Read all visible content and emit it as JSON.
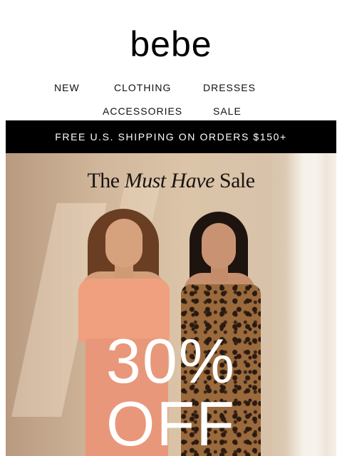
{
  "brand": {
    "logo_text": "bebe"
  },
  "nav": {
    "row1": [
      "NEW",
      "CLOTHING",
      "DRESSES"
    ],
    "row2": [
      "ACCESSORIES",
      "SALE"
    ]
  },
  "shipping_banner": "FREE U.S. SHIPPING ON ORDERS $150+",
  "hero": {
    "headline_pre": "The ",
    "headline_em": "Must Have",
    "headline_post": " Sale",
    "promo_line1": "30%",
    "promo_line2": "OFF"
  }
}
